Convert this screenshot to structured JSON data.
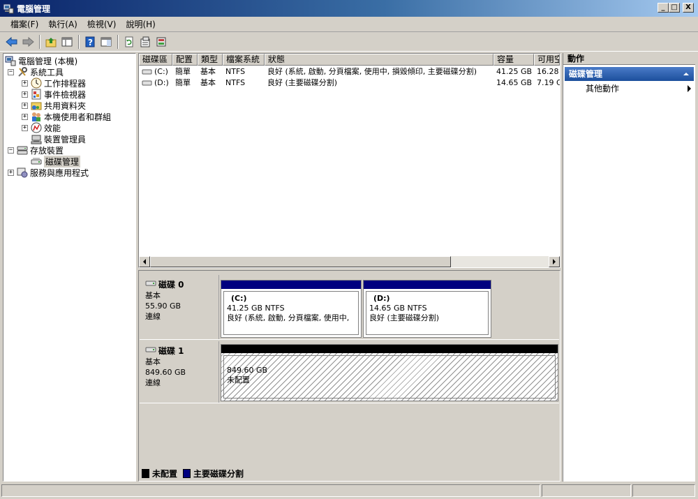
{
  "window": {
    "title": "電腦管理",
    "buttons": {
      "minimize": "_",
      "maximize": "□",
      "close": "X"
    }
  },
  "menu": [
    "檔案(F)",
    "執行(A)",
    "檢視(V)",
    "說明(H)"
  ],
  "toolbar": [
    "back-icon",
    "forward-icon",
    "up-folder-icon",
    "show-hide-tree-icon",
    "help-icon",
    "show-hide-action-pane-icon",
    "refresh-icon",
    "properties-icon",
    "export-icon"
  ],
  "tree": {
    "root": "電腦管理 (本機)",
    "items": [
      {
        "label": "系統工具",
        "level": 1,
        "expander": "−",
        "icon": "tools-icon"
      },
      {
        "label": "工作排程器",
        "level": 2,
        "expander": "+",
        "icon": "clock-icon"
      },
      {
        "label": "事件檢視器",
        "level": 2,
        "expander": "+",
        "icon": "event-viewer-icon"
      },
      {
        "label": "共用資料夾",
        "level": 2,
        "expander": "+",
        "icon": "shared-folder-icon"
      },
      {
        "label": "本機使用者和群組",
        "level": 2,
        "expander": "+",
        "icon": "users-icon"
      },
      {
        "label": "效能",
        "level": 2,
        "expander": "+",
        "icon": "performance-icon"
      },
      {
        "label": "裝置管理員",
        "level": 2,
        "expander": "",
        "icon": "device-manager-icon"
      },
      {
        "label": "存放裝置",
        "level": 1,
        "expander": "−",
        "icon": "storage-icon"
      },
      {
        "label": "磁碟管理",
        "level": 2,
        "expander": "",
        "icon": "disk-management-icon",
        "selected": true
      },
      {
        "label": "服務與應用程式",
        "level": 1,
        "expander": "+",
        "icon": "services-icon"
      }
    ]
  },
  "volume_list": {
    "columns": [
      "磁碟區",
      "配置",
      "類型",
      "檔案系統",
      "狀態",
      "容量",
      "可用空"
    ],
    "rows": [
      {
        "volume": "(C:)",
        "layout": "簡單",
        "type": "基本",
        "fs": "NTFS",
        "status": "良好 (系統, 啟動, 分頁檔案, 使用中, 損毀傾印, 主要磁碟分割)",
        "capacity": "41.25 GB",
        "free": "16.28"
      },
      {
        "volume": "(D:)",
        "layout": "簡單",
        "type": "基本",
        "fs": "NTFS",
        "status": "良好 (主要磁碟分割)",
        "capacity": "14.65 GB",
        "free": "7.19 G"
      }
    ]
  },
  "disks": [
    {
      "name": "磁碟 0",
      "type": "基本",
      "size": "55.90 GB",
      "state": "連線",
      "partitions": [
        {
          "letter": "(C:)",
          "size": "41.25 GB NTFS",
          "status": "良好 (系統, 啟動, 分頁檔案, 使用中,"
        },
        {
          "letter": "(D:)",
          "size": "14.65 GB NTFS",
          "status": "良好 (主要磁碟分割)"
        }
      ]
    },
    {
      "name": "磁碟 1",
      "type": "基本",
      "size": "849.60 GB",
      "state": "連線",
      "unallocated": {
        "size": "849.60 GB",
        "label": "未配置"
      }
    }
  ],
  "legend": [
    {
      "label": "未配置",
      "color": "#000000"
    },
    {
      "label": "主要磁碟分割",
      "color": "#00007f"
    }
  ],
  "actions": {
    "header": "動作",
    "section": "磁碟管理",
    "items": [
      "其他動作"
    ]
  }
}
